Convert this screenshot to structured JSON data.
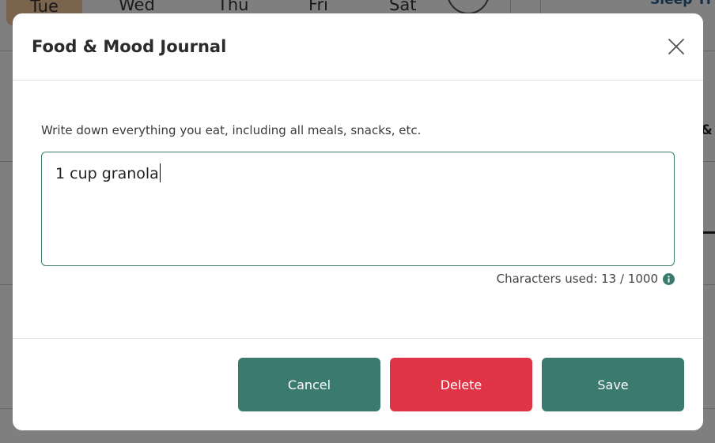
{
  "background": {
    "days": [
      "Tue",
      "Wed",
      "Thu",
      "Fri",
      "Sat"
    ],
    "sleep_label": "Sleep Ti",
    "amp_fragment": "&"
  },
  "modal": {
    "title": "Food & Mood Journal",
    "close_icon": "close-icon",
    "prompt": "Write down everything you eat, including all meals, snacks, etc.",
    "entry_text": "1 cup granola",
    "char_count_label": "Characters used: 13 / 1000",
    "info_icon": "info-icon",
    "buttons": {
      "cancel": "Cancel",
      "delete": "Delete",
      "save": "Save"
    }
  },
  "colors": {
    "primary": "#3b7a6e",
    "danger": "#de3446",
    "overlay": "rgba(0,0,0,0.5)"
  }
}
